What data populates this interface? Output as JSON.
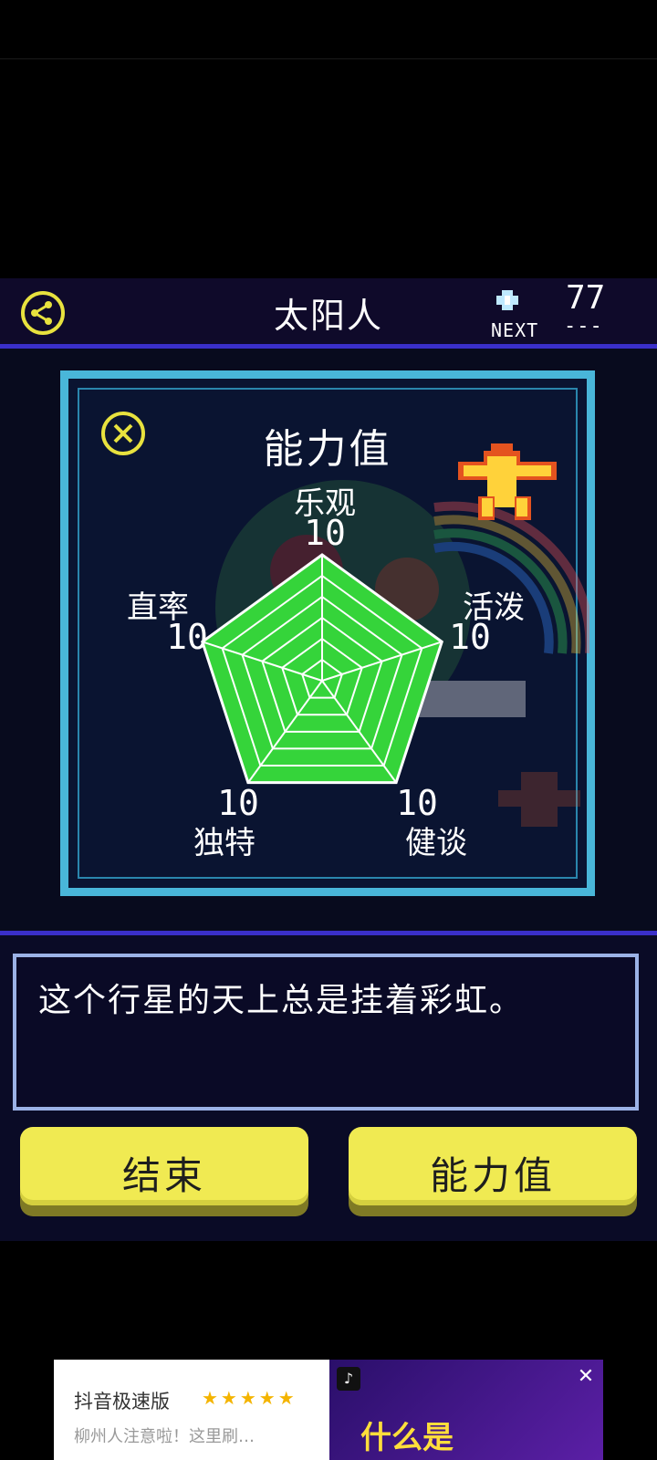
{
  "header": {
    "title": "太阳人",
    "next_label": "NEXT",
    "count": "77",
    "count_dash": "---"
  },
  "panel": {
    "title": "能力值"
  },
  "chart_data": {
    "type": "radar",
    "axes": [
      "乐观",
      "活泼",
      "健谈",
      "独特",
      "直率"
    ],
    "values": [
      10,
      10,
      10,
      10,
      10
    ],
    "max": 10,
    "rings": 6,
    "fill_color": "#35d43a"
  },
  "stats": {
    "top": {
      "label": "乐观",
      "value": "10"
    },
    "right": {
      "label": "活泼",
      "value": "10"
    },
    "bottom_right": {
      "label": "健谈",
      "value": "10"
    },
    "bottom_left": {
      "label": "独特",
      "value": "10"
    },
    "left": {
      "label": "直率",
      "value": "10"
    }
  },
  "description": "这个行星的天上总是挂着彩虹。",
  "buttons": {
    "end": "结束",
    "ability": "能力值"
  },
  "ad": {
    "title": "抖音极速版",
    "stars": "★★★★★",
    "subtitle": "柳州人注意啦！这里刷…",
    "brand": "♪",
    "headline": "什么是",
    "close": "✕"
  },
  "colors": {
    "accent_yellow": "#f0ea52",
    "frame_cyan": "#49b6d9",
    "rule_blue": "#3a2fc9"
  }
}
